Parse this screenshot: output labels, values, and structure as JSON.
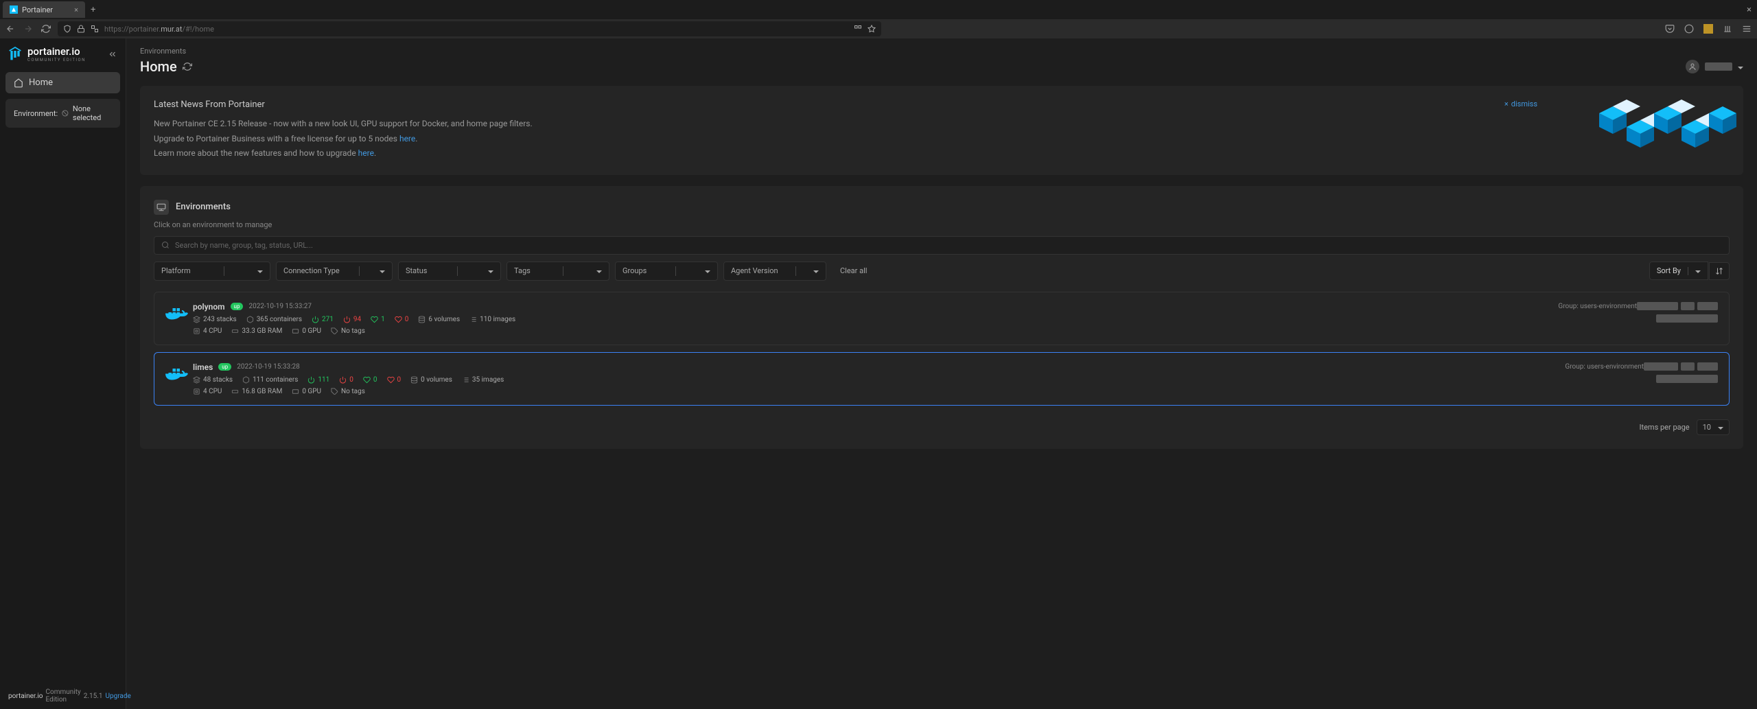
{
  "browser": {
    "tab_title": "Portainer",
    "url_protocol": "https://",
    "url_dim": "portainer.",
    "url_host": "mur.at",
    "url_path": "/#!/home"
  },
  "sidebar": {
    "brand": "portainer.io",
    "edition": "COMMUNITY EDITION",
    "nav": {
      "home": "Home"
    },
    "env_label": "Environment:",
    "env_value": "None selected",
    "footer_brand": "portainer.io",
    "footer_edition": "Community Edition",
    "footer_version": "2.15.1",
    "footer_upgrade": "Upgrade"
  },
  "header": {
    "breadcrumb": "Environments",
    "title": "Home"
  },
  "news": {
    "title": "Latest News From Portainer",
    "line1": "New Portainer CE 2.15 Release - now with a new look UI, GPU support for Docker, and home page filters.",
    "line2_a": "Upgrade to Portainer Business with a free license for up to 5 nodes ",
    "line2_link": "here",
    "line3_a": "Learn more about the new features and how to upgrade ",
    "line3_link": "here",
    "dismiss": "dismiss"
  },
  "environments": {
    "title": "Environments",
    "hint": "Click on an environment to manage",
    "search_placeholder": "Search by name, group, tag, status, URL...",
    "filters": {
      "platform": "Platform",
      "connection_type": "Connection Type",
      "status": "Status",
      "tags": "Tags",
      "groups": "Groups",
      "agent_version": "Agent Version"
    },
    "clear_all": "Clear all",
    "sort_by": "Sort By",
    "items": [
      {
        "name": "polynom",
        "status": "up",
        "timestamp": "2022-10-19 15:33:27",
        "group": "Group: users-environment",
        "stacks": "243 stacks",
        "containers": "365 containers",
        "running": "271",
        "stopped": "94",
        "healthy": "1",
        "unhealthy": "0",
        "volumes": "6 volumes",
        "images": "110 images",
        "cpu": "4 CPU",
        "ram": "33.3 GB RAM",
        "gpu": "0 GPU",
        "tags": "No tags"
      },
      {
        "name": "limes",
        "status": "up",
        "timestamp": "2022-10-19 15:33:28",
        "group": "Group: users-environment",
        "stacks": "48 stacks",
        "containers": "111 containers",
        "running": "111",
        "stopped": "0",
        "healthy": "0",
        "unhealthy": "0",
        "volumes": "0 volumes",
        "images": "35 images",
        "cpu": "4 CPU",
        "ram": "16.8 GB RAM",
        "gpu": "0 GPU",
        "tags": "No tags"
      }
    ],
    "items_per_page_label": "Items per page",
    "items_per_page": "10"
  }
}
